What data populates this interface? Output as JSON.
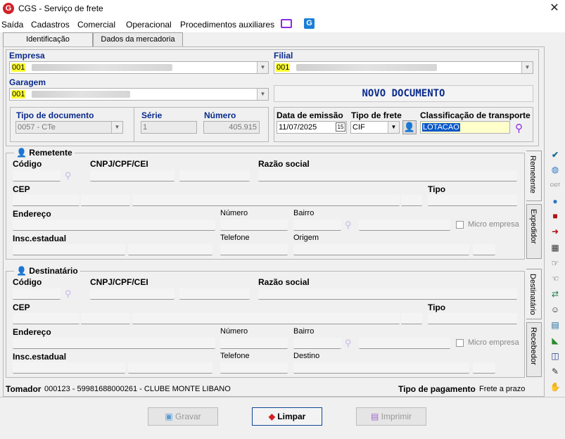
{
  "window": {
    "title": "CGS - Serviço de frete",
    "close": "✕"
  },
  "menu": {
    "items": [
      "Saída",
      "Cadastros",
      "Comercial",
      "Operacional",
      "Procedimentos auxiliares"
    ]
  },
  "tabs": [
    "Identificação",
    "Dados da mercadoria"
  ],
  "top": {
    "empresa_label": "Empresa",
    "empresa_code": "001",
    "filial_label": "Filial",
    "filial_code": "001",
    "garagem_label": "Garagem",
    "garagem_code": "001",
    "novo_documento": "NOVO DOCUMENTO"
  },
  "doc": {
    "tipo_label": "Tipo de documento",
    "tipo_value": "0057 - CTe",
    "serie_label": "Série",
    "serie_value": "1",
    "numero_label": "Número",
    "numero_value": "405.915"
  },
  "freight": {
    "data_label": "Data de emissão",
    "data_value": "11/07/2025",
    "calendar_num": "15",
    "tipo_label": "Tipo de frete",
    "tipo_value": "CIF",
    "class_label": "Classificação de transporte",
    "class_value": "LOTACAO"
  },
  "remetente": {
    "legend": "Remetente",
    "codigo": "Código",
    "cnpj": "CNPJ/CPF/CEI",
    "razao": "Razão social",
    "cep": "CEP",
    "tipo": "Tipo",
    "endereco": "Endereço",
    "numero": "Número",
    "bairro": "Bairro",
    "micro": "Micro empresa",
    "insc": "Insc.estadual",
    "telefone": "Telefone",
    "origem": "Origem"
  },
  "destinatario": {
    "legend": "Destinatário",
    "codigo": "Código",
    "cnpj": "CNPJ/CPF/CEI",
    "razao": "Razão social",
    "cep": "CEP",
    "tipo": "Tipo",
    "endereco": "Endereço",
    "numero": "Número",
    "bairro": "Bairro",
    "micro": "Micro empresa",
    "insc": "Insc.estadual",
    "telefone": "Telefone",
    "destino": "Destino"
  },
  "vtabs": [
    "Remetente",
    "Expedidor",
    "Destinatário",
    "Recebedor"
  ],
  "footer": {
    "tomador_label": "Tomador",
    "tomador_value": "000123 - 59981688000261 - CLUBE MONTE LIBANO",
    "pagamento_label": "Tipo de pagamento",
    "pagamento_value": "Frete a prazo"
  },
  "buttons": {
    "gravar": "Gravar",
    "limpar": "Limpar",
    "imprimir": "Imprimir"
  },
  "side_icons": [
    "check-icon",
    "globe-refresh-icon",
    "ciot-icon",
    "globe-icon",
    "truck-red-icon",
    "document-arrow-icon",
    "documents-icon",
    "hand-pointing-icon",
    "hand-doc-icon",
    "people-swap-icon",
    "person-icon",
    "calendar-check-icon",
    "truck-green-icon",
    "book-icon",
    "document-edit-icon",
    "handshake-icon"
  ],
  "colors": {
    "highlight": "#ffff33",
    "title_blue": "#0a2b8c",
    "class_fill": "#ffffcc"
  }
}
